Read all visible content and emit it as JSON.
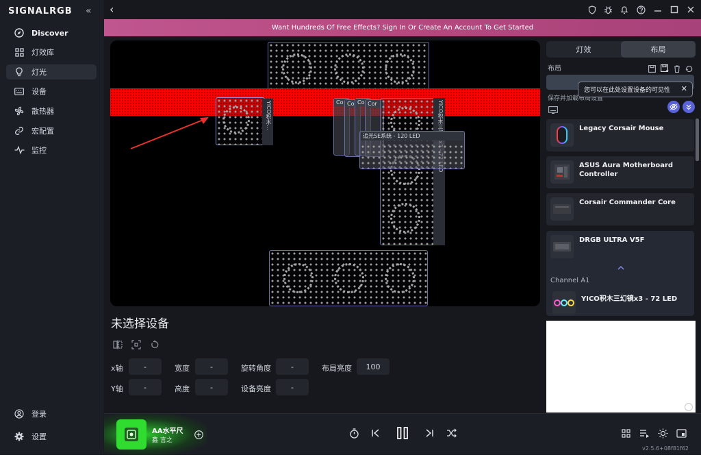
{
  "app": {
    "logo": "SIGNALRGB",
    "collapse_icon": "double-chevron-left-icon"
  },
  "sidebar": {
    "items": [
      {
        "label": "Discover",
        "icon": "compass-icon"
      },
      {
        "label": "灯效库",
        "icon": "grid-icon"
      },
      {
        "label": "灯光",
        "icon": "bulb-icon"
      },
      {
        "label": "设备",
        "icon": "keyboard-icon"
      },
      {
        "label": "散热器",
        "icon": "fan-icon"
      },
      {
        "label": "宏配置",
        "icon": "link-icon"
      },
      {
        "label": "监控",
        "icon": "pulse-icon"
      }
    ],
    "bottom": [
      {
        "label": "登录",
        "icon": "user-icon"
      },
      {
        "label": "设置",
        "icon": "gear-icon"
      }
    ]
  },
  "banner": {
    "text": "Want Hundreds Of Free Effects? Sign In Or Create An Account To Get Started"
  },
  "canvas": {
    "labels": {
      "yico_small": "YICO积木...",
      "yico_big": "YICO积木三幻镜x3 - 72 LED",
      "co1": "Co",
      "co2": "Co",
      "co3": "Co",
      "cor": "Cor",
      "light_system": "追光SE系统 - 120 LED"
    }
  },
  "details": {
    "title": "未选择设备",
    "fields": {
      "x_label": "x轴",
      "x_value": "-",
      "width_label": "宽度",
      "width_value": "-",
      "rotate_label": "旋转角度",
      "rotate_value": "-",
      "layout_brightness_label": "布局亮度",
      "layout_brightness_value": "100",
      "y_label": "Y轴",
      "y_value": "-",
      "height_label": "高度",
      "height_value": "-",
      "device_brightness_label": "设备亮度",
      "device_brightness_value": "-"
    }
  },
  "right_panel": {
    "tabs": [
      "灯效",
      "布局"
    ],
    "layout_label": "布局",
    "save_hint": "保存并加载布局设置",
    "tooltip": "您可以在此处设置设备的可见性",
    "devices": [
      {
        "name": "Legacy Corsair Mouse"
      },
      {
        "name": "ASUS Aura Motherboard Controller"
      },
      {
        "name": "Corsair Commander Core"
      },
      {
        "name": "DRGB ULTRA V5F"
      }
    ],
    "channel": "Channel A1",
    "channel_device": "YICO积木三幻镜x3 - 72 LED"
  },
  "player": {
    "title": "AA水平尺",
    "author": "鑫 言之",
    "version": "v2.5.6+08f81f62"
  },
  "colors": {
    "accent_red": "#ff0000",
    "banner": "#b74a82",
    "highlight_green": "#2fe02f"
  }
}
